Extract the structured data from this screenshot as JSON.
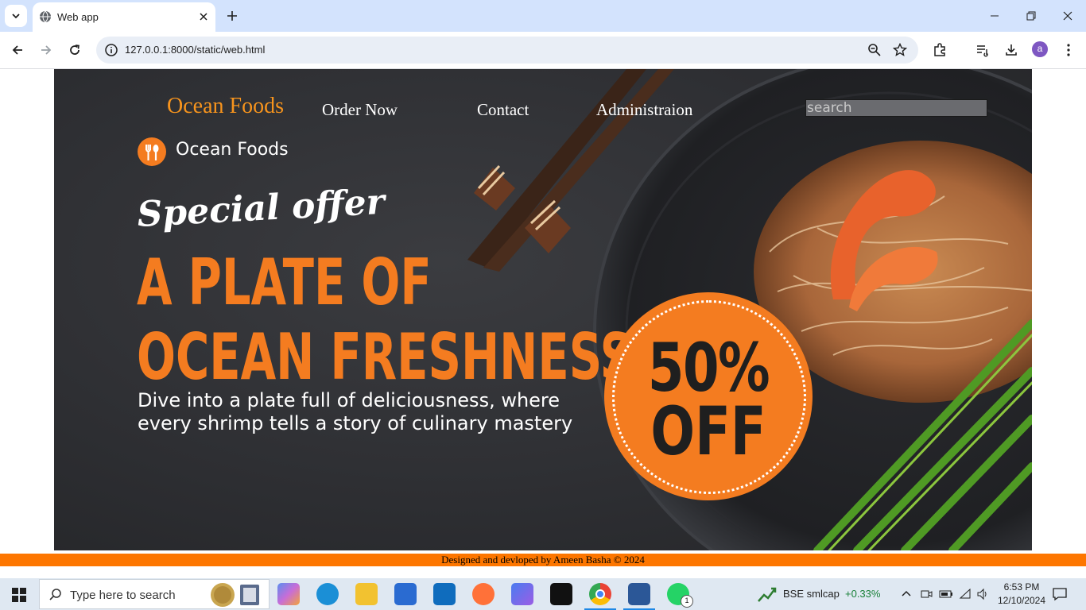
{
  "browser": {
    "tab_title": "Web app",
    "url": "127.0.0.1:8000/static/web.html",
    "profile_initial": "a"
  },
  "page": {
    "nav": {
      "brand": "Ocean Foods",
      "links": [
        "Order Now",
        "Contact",
        "Administraion"
      ],
      "search_placeholder": "search"
    },
    "logo_text": "Ocean Foods",
    "special": "Special offer",
    "headline": [
      "A PLATE OF",
      "OCEAN FRESHNESS"
    ],
    "subtext": "Dive into a plate full of deliciousness, where every shrimp tells a story of culinary mastery",
    "badge": {
      "pct": "50%",
      "off": "OFF"
    },
    "footer": "Designed and devloped by Ameen Basha © 2024"
  },
  "taskbar": {
    "search_placeholder": "Type here to search",
    "stock_name": "BSE smlcap",
    "stock_change": "+0.33%",
    "time": "6:53 PM",
    "date": "12/10/2024",
    "whatsapp_badge": "1"
  },
  "colors": {
    "accent": "#f47c20",
    "footer": "#fd7600",
    "tabstrip": "#d3e3fd"
  }
}
